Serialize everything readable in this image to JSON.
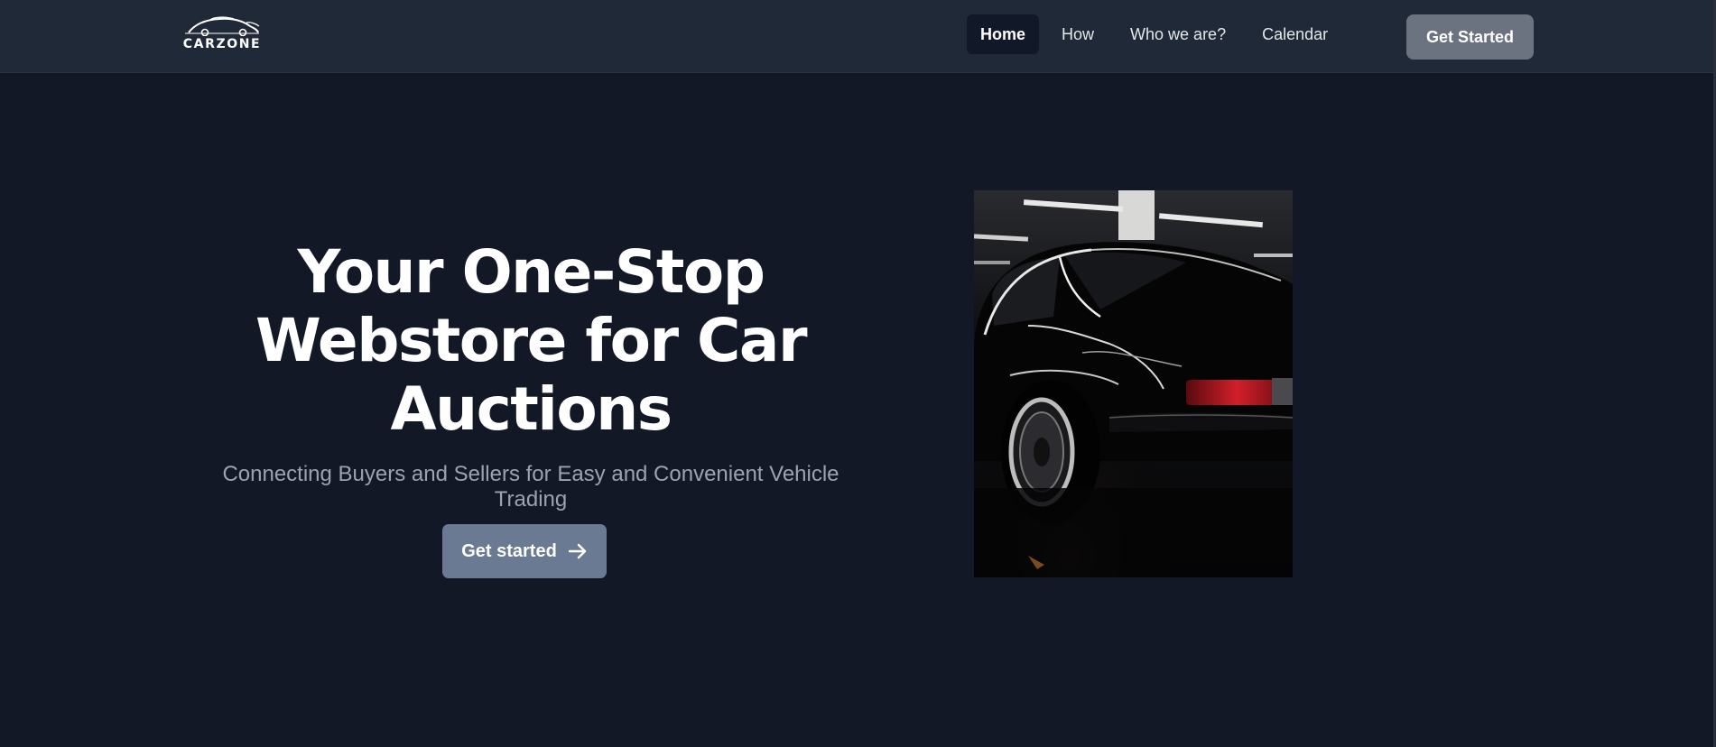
{
  "brand": {
    "name": "CARZONE",
    "logo_icon": "car-silhouette-icon"
  },
  "nav": {
    "items": [
      {
        "label": "Home",
        "active": true
      },
      {
        "label": "How",
        "active": false
      },
      {
        "label": "Who we are?",
        "active": false
      },
      {
        "label": "Calendar",
        "active": false
      }
    ],
    "cta_label": "Get Started"
  },
  "hero": {
    "title_lines": [
      "Your One-Stop",
      "Webstore for Car",
      "Auctions"
    ],
    "subtitle": "Connecting Buyers and Sellers for Easy and Convenient Vehicle Trading",
    "cta_label": "Get started",
    "cta_icon": "arrow-right-icon",
    "image": "black sports car in dark garage"
  },
  "colors": {
    "page_bg": "#121826",
    "navbar_bg": "#1f2937",
    "active_nav_bg": "#111827",
    "header_cta_bg": "#6b7280",
    "hero_cta_bg": "#6b7a93",
    "subtitle": "#9ca3af"
  }
}
